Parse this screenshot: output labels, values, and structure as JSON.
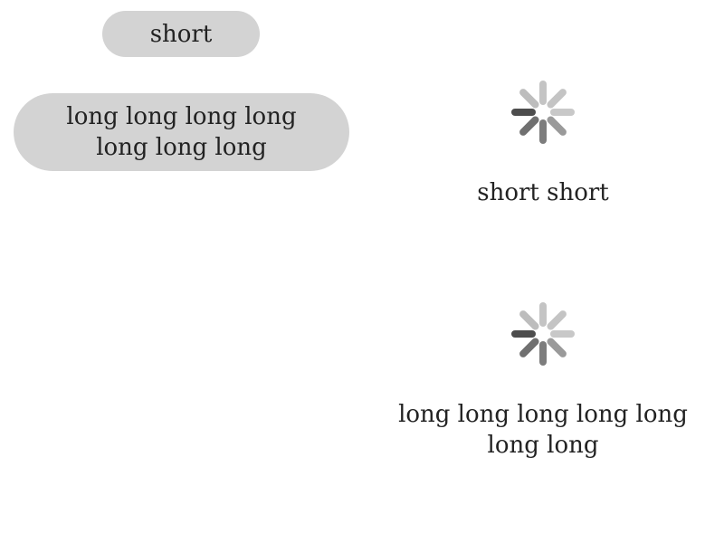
{
  "toasts": {
    "short_text": "short",
    "long_text": "long long long long long long long"
  },
  "loaders": [
    {
      "icon": "spinner-icon",
      "text": "short short"
    },
    {
      "icon": "spinner-icon",
      "text": "long long long long long long long"
    }
  ],
  "colors": {
    "toast_background": "#d3d3d3",
    "text": "#222222",
    "spinner_dark": "#4a4a4a",
    "spinner_light": "#c8c8c8"
  }
}
